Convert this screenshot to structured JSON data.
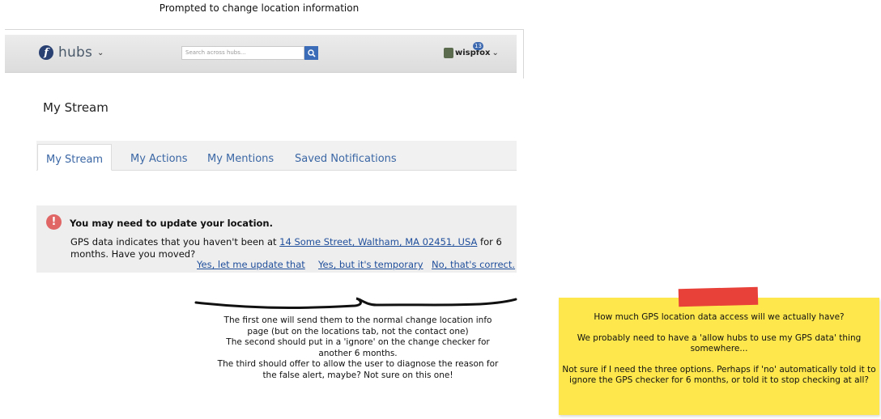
{
  "caption": "Prompted to change location information",
  "header": {
    "logo_text": "hubs",
    "search_placeholder": "Search across hubs...",
    "username": "wispfox",
    "notification_count": "13"
  },
  "page_title": "My Stream",
  "tabs": [
    {
      "label": "My Stream",
      "active": true
    },
    {
      "label": "My Actions",
      "active": false
    },
    {
      "label": "My Mentions",
      "active": false
    },
    {
      "label": "Saved Notifications",
      "active": false
    }
  ],
  "alert": {
    "icon": "!",
    "title": "You may need to update your location.",
    "body_prefix": "GPS data indicates that you haven't been at ",
    "address": "14 Some Street, Waltham, MA 02451, USA",
    "body_suffix": " for 6 months. Have you moved?",
    "actions": [
      "Yes, let me update that",
      "Yes, but it's temporary",
      "No, that's correct."
    ]
  },
  "note_left": [
    "The first one will send them to the normal change location info",
    "page (but on the locations tab, not the contact one)",
    "The second should put in a 'ignore' on the change checker for",
    "another 6 months.",
    "The third should offer to allow the user to diagnose the reason for",
    "the false alert, maybe? Not sure on this one!"
  ],
  "sticky_note": [
    "How much GPS location data access will we actually have?",
    "We probably need to have a 'allow hubs to use my GPS data' thing somewhere...",
    "Not sure if I need the three options. Perhaps if 'no' automatically told it to ignore the GPS checker for 6 months, or told it to stop checking at all?"
  ]
}
